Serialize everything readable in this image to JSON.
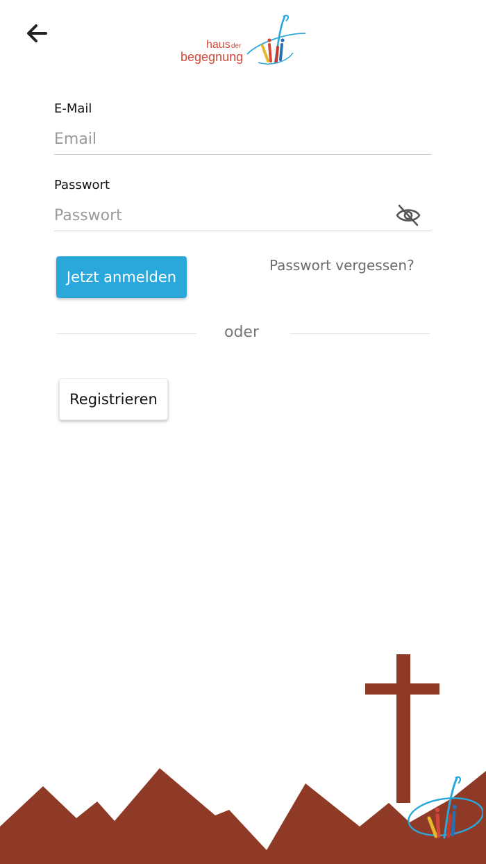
{
  "header": {
    "back_icon": "arrow-left-icon",
    "logo": {
      "line1": "haus",
      "line1_small": "der",
      "line2": "begegnung"
    }
  },
  "form": {
    "email_label": "E-Mail",
    "email_placeholder": "Email",
    "password_label": "Passwort",
    "password_placeholder": "Passwort",
    "password_toggle_icon": "eye-off-icon"
  },
  "actions": {
    "login_label": "Jetzt anmelden",
    "forgot_label": "Passwort vergessen?",
    "divider_label": "oder",
    "register_label": "Registrieren"
  },
  "colors": {
    "accent": "#2aa8dc",
    "brand_red": "#d4483b",
    "landscape": "#8e3a26"
  }
}
